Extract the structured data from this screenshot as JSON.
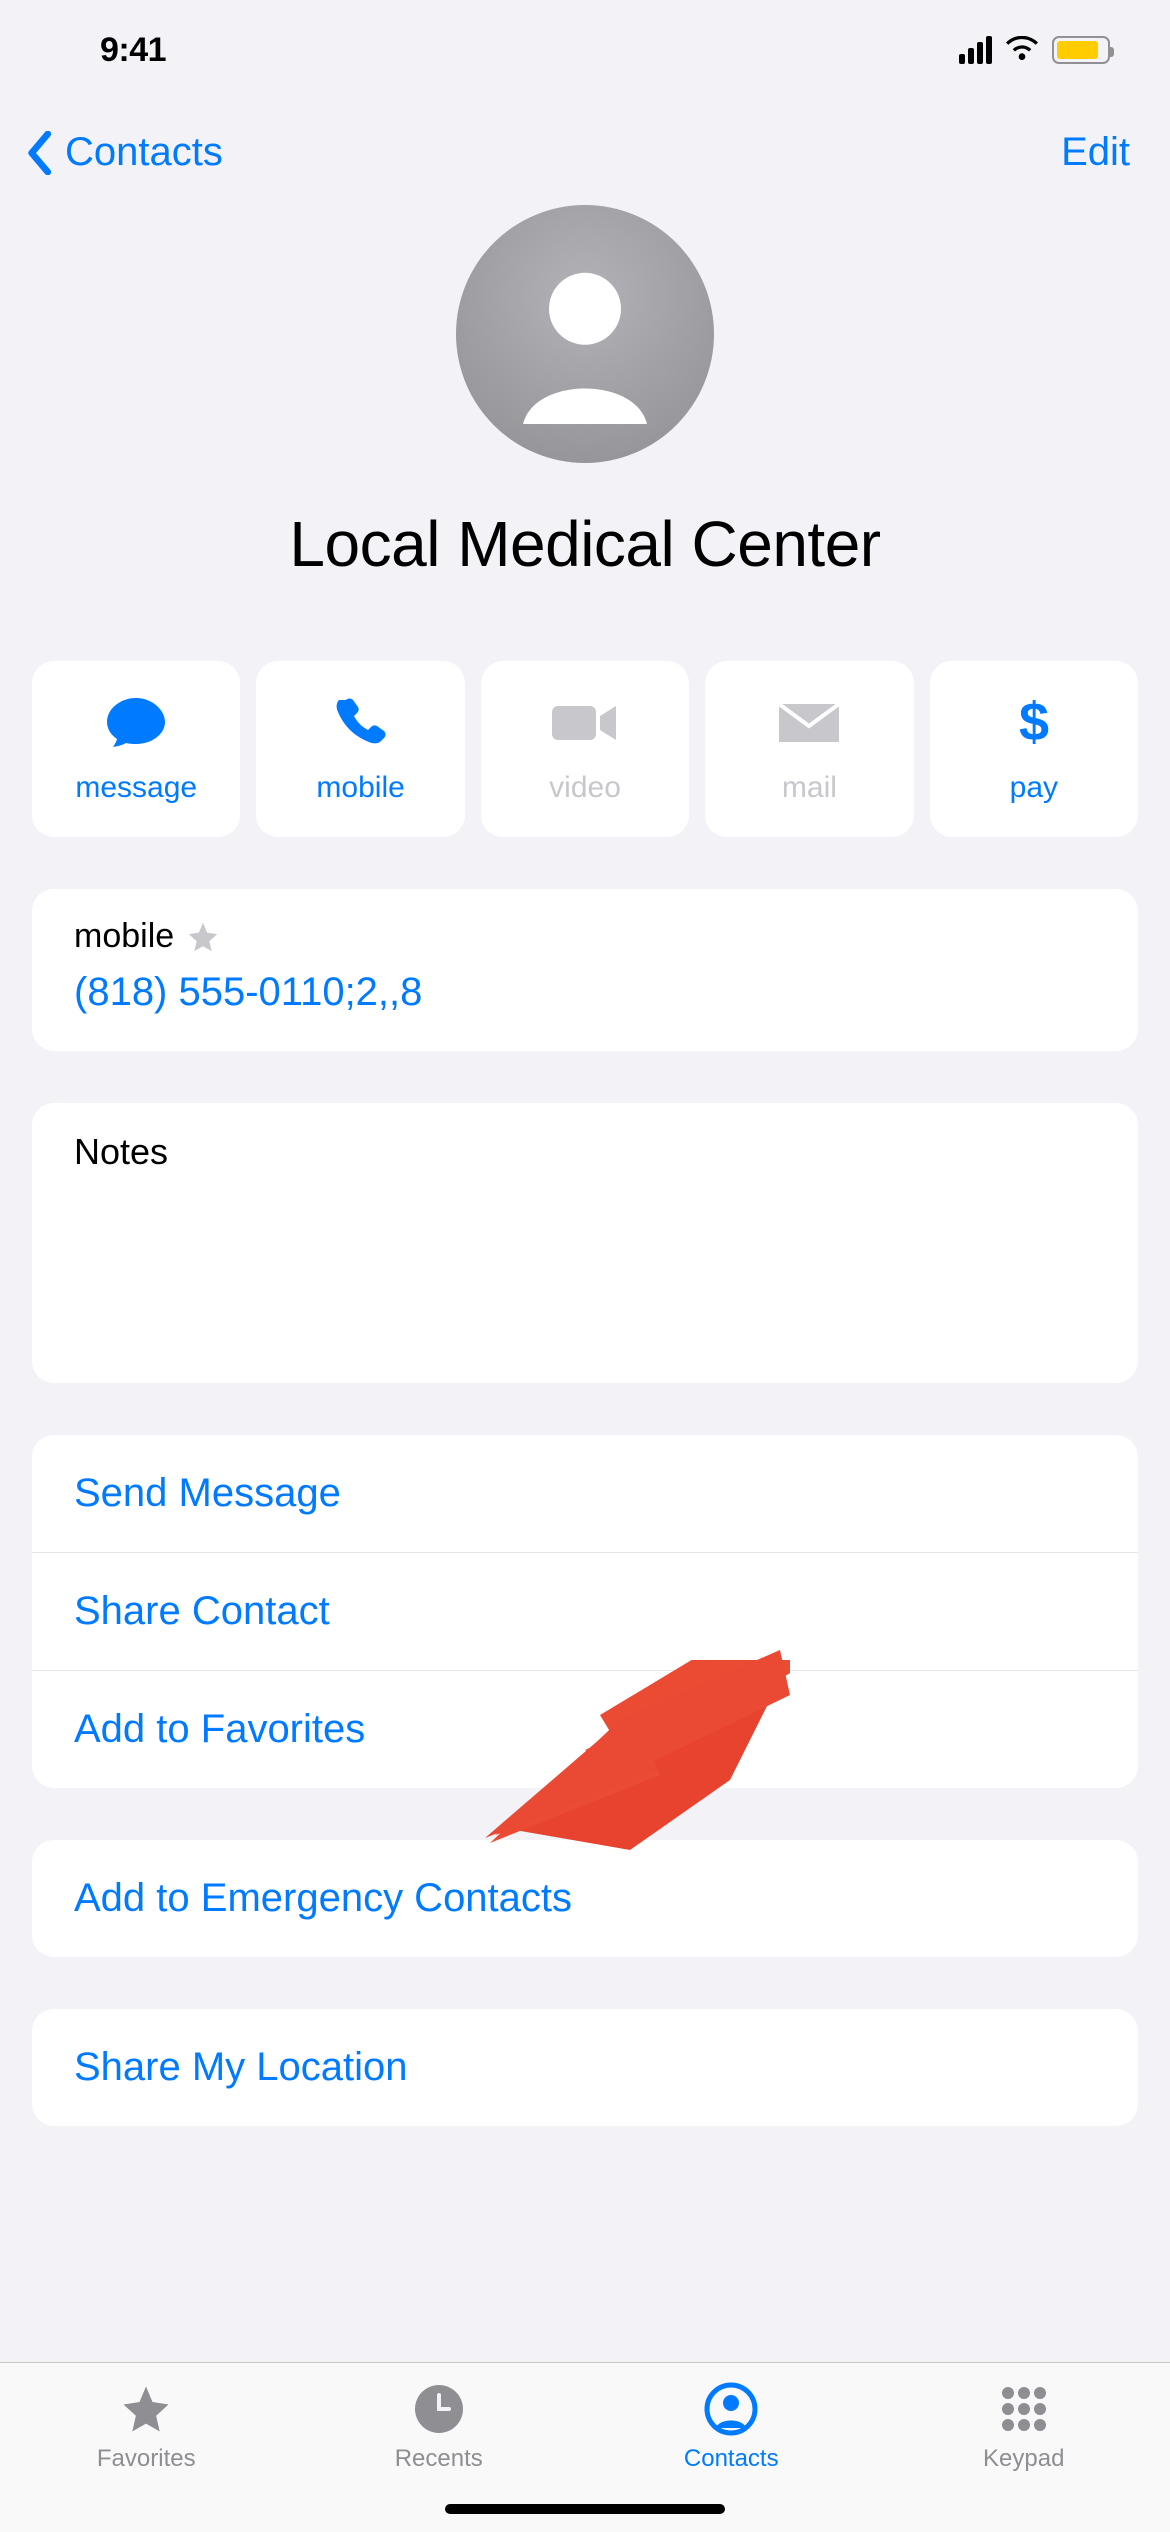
{
  "status_bar": {
    "time": "9:41"
  },
  "nav": {
    "back_label": "Contacts",
    "edit_label": "Edit"
  },
  "contact": {
    "name": "Local Medical Center",
    "phone": {
      "label": "mobile",
      "number": "(818) 555-0110;2,,8"
    },
    "notes_label": "Notes"
  },
  "actions": {
    "message": "message",
    "call": "mobile",
    "video": "video",
    "mail": "mail",
    "pay": "pay"
  },
  "links": {
    "send_message": "Send Message",
    "share_contact": "Share Contact",
    "add_favorites": "Add to Favorites",
    "add_emergency": "Add to Emergency Contacts",
    "share_location": "Share My Location"
  },
  "tabs": {
    "favorites": "Favorites",
    "recents": "Recents",
    "contacts": "Contacts",
    "keypad": "Keypad"
  }
}
